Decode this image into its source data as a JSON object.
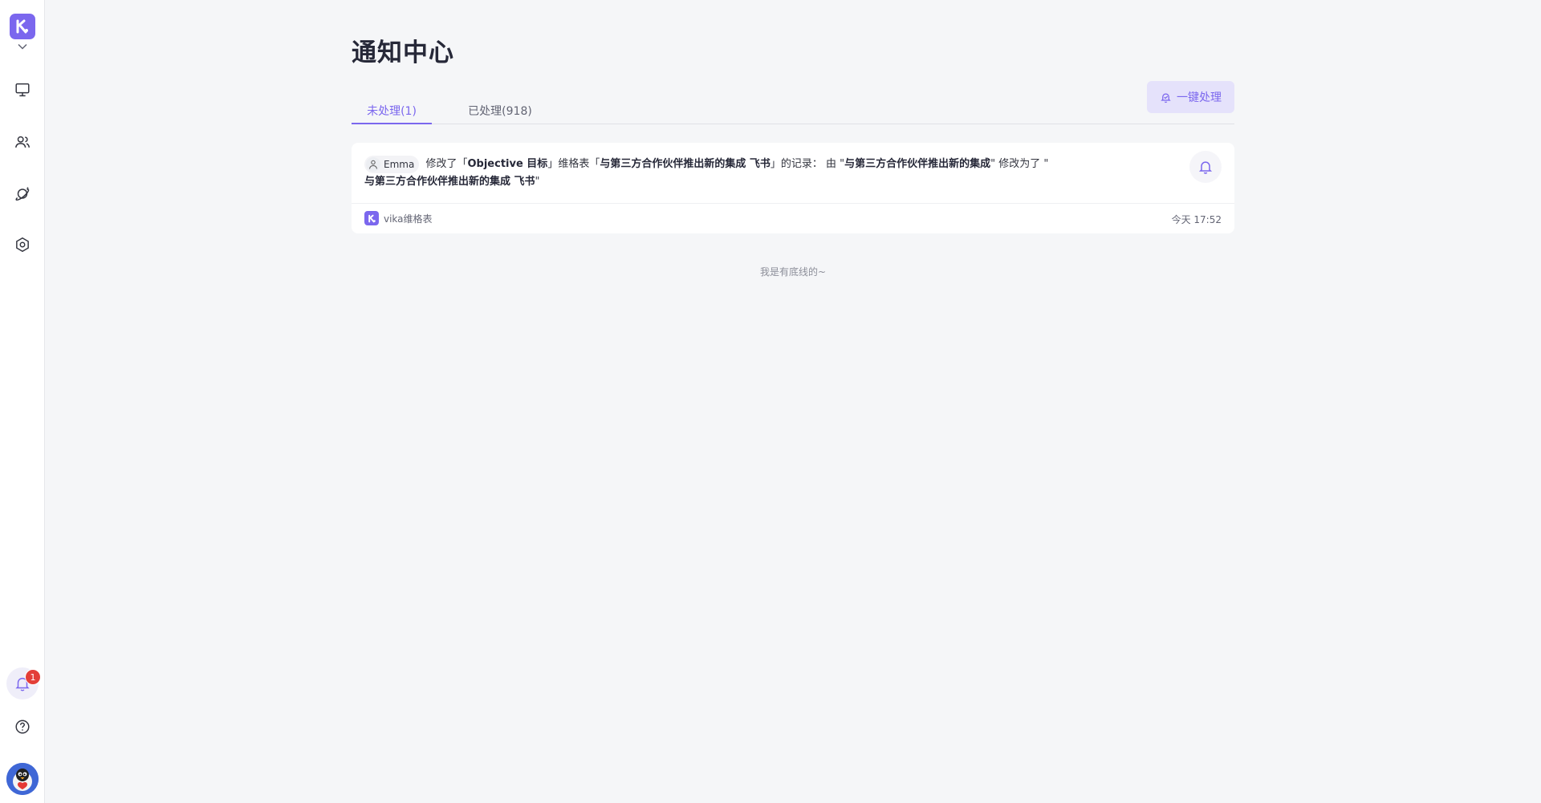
{
  "page": {
    "title": "通知中心"
  },
  "tabs": [
    {
      "label": "未处理(1)",
      "active": true
    },
    {
      "label": "已处理(918)",
      "active": false
    }
  ],
  "actions": {
    "process_all_label": "一键处理"
  },
  "notifications": [
    {
      "user": "Emma",
      "text_1": "修改了「",
      "table_name": "Objective 目标",
      "text_2": "」维格表「",
      "record_name": "与第三方合作伙伴推出新的集成 飞书",
      "text_3": "」的记录： 由 \"",
      "old_value": "与第三方合作伙伴推出新的集成",
      "text_4": "\" 修改为了 \"",
      "new_value": "与第三方合作伙伴推出新的集成 飞书",
      "text_5": "\"",
      "source": "vika维格表",
      "time": "今天 17:52"
    }
  ],
  "footer": {
    "end_text": "我是有底线的~"
  },
  "sidebar": {
    "notification_count": "1",
    "items": [
      {
        "icon": "monitor-icon"
      },
      {
        "icon": "users-icon"
      },
      {
        "icon": "planet-icon"
      },
      {
        "icon": "settings-hexagon-icon"
      },
      {
        "icon": "bell-icon"
      },
      {
        "icon": "help-circle-icon"
      }
    ]
  },
  "colors": {
    "accent": "#7b67ee",
    "badge": "#e33e38",
    "background": "#f5f6f8"
  }
}
